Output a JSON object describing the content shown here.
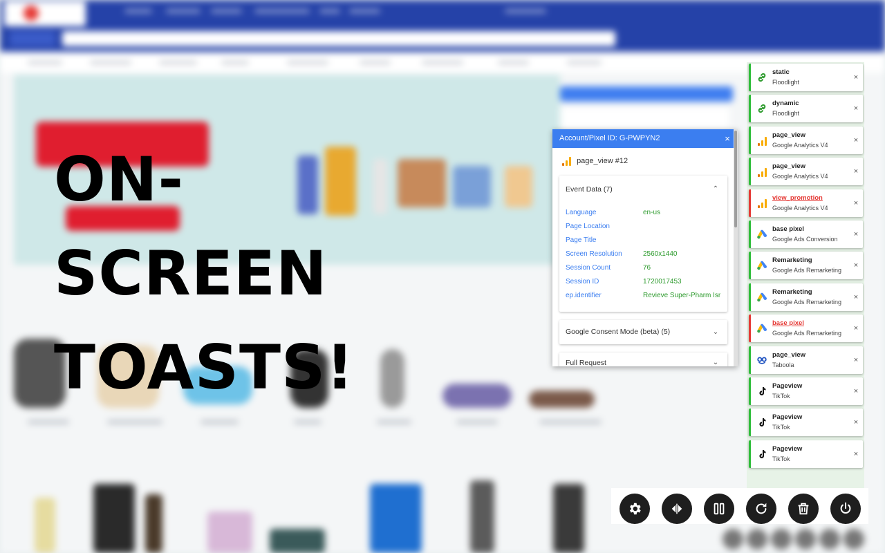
{
  "caption": {
    "line1": "ON-",
    "line2": "SCREEN",
    "line3": "TOASTS!"
  },
  "panel": {
    "title": "Account/Pixel ID: G-PWPYN2",
    "close_label": "×",
    "event_label": "page_view #12",
    "event_icon": "google-analytics-icon",
    "sections": {
      "event_data": {
        "title": "Event Data (7)",
        "rows": [
          {
            "key": "Language",
            "value": "en-us"
          },
          {
            "key": "Page Location",
            "value": ""
          },
          {
            "key": "Page Title",
            "value": ""
          },
          {
            "key": "Screen Resolution",
            "value": "2560x1440"
          },
          {
            "key": "Session Count",
            "value": "76"
          },
          {
            "key": "Session ID",
            "value": "1720017453"
          },
          {
            "key": "ep.identifier",
            "value": "Revieve Super-Pharm Isr"
          }
        ]
      },
      "consent": {
        "title": "Google Consent Mode (beta) (5)"
      },
      "full_request": {
        "title": "Full Request"
      }
    }
  },
  "toasts": [
    {
      "name": "static",
      "sub": "Floodlight",
      "icon": "link-icon",
      "status": "ok"
    },
    {
      "name": "dynamic",
      "sub": "Floodlight",
      "icon": "link-icon",
      "status": "ok"
    },
    {
      "name": "page_view",
      "sub": "Google Analytics V4",
      "icon": "google-analytics-icon",
      "status": "ok"
    },
    {
      "name": "page_view",
      "sub": "Google Analytics V4",
      "icon": "google-analytics-icon",
      "status": "ok"
    },
    {
      "name": "view_promotion",
      "sub": "Google Analytics V4",
      "icon": "google-analytics-icon",
      "status": "error"
    },
    {
      "name": "base pixel",
      "sub": "Google Ads Conversion",
      "icon": "google-ads-icon",
      "status": "ok"
    },
    {
      "name": "Remarketing",
      "sub": "Google Ads Remarketing",
      "icon": "google-ads-icon",
      "status": "ok"
    },
    {
      "name": "Remarketing",
      "sub": "Google Ads Remarketing",
      "icon": "google-ads-icon",
      "status": "ok"
    },
    {
      "name": "base pixel",
      "sub": "Google Ads Remarketing",
      "icon": "google-ads-icon",
      "status": "error"
    },
    {
      "name": "page_view",
      "sub": "Taboola",
      "icon": "taboola-icon",
      "status": "ok"
    },
    {
      "name": "Pageview",
      "sub": "TikTok",
      "icon": "tiktok-icon",
      "status": "ok"
    },
    {
      "name": "Pageview",
      "sub": "TikTok",
      "icon": "tiktok-icon",
      "status": "ok"
    },
    {
      "name": "Pageview",
      "sub": "TikTok",
      "icon": "tiktok-icon",
      "status": "ok"
    }
  ],
  "toast_close_label": "×",
  "actions": [
    {
      "name": "settings-button",
      "icon": "gear-icon"
    },
    {
      "name": "toggle-side-button",
      "icon": "swap-horizontal-icon"
    },
    {
      "name": "pause-button",
      "icon": "pause-icon"
    },
    {
      "name": "refresh-button",
      "icon": "refresh-icon"
    },
    {
      "name": "delete-button",
      "icon": "trash-icon"
    },
    {
      "name": "power-button",
      "icon": "power-icon"
    }
  ],
  "colors": {
    "ok": "#2ebd3a",
    "error": "#e53935",
    "panel_header": "#3b7ef0",
    "key_text": "#3b7ef0",
    "value_text": "#2e9b2e"
  }
}
